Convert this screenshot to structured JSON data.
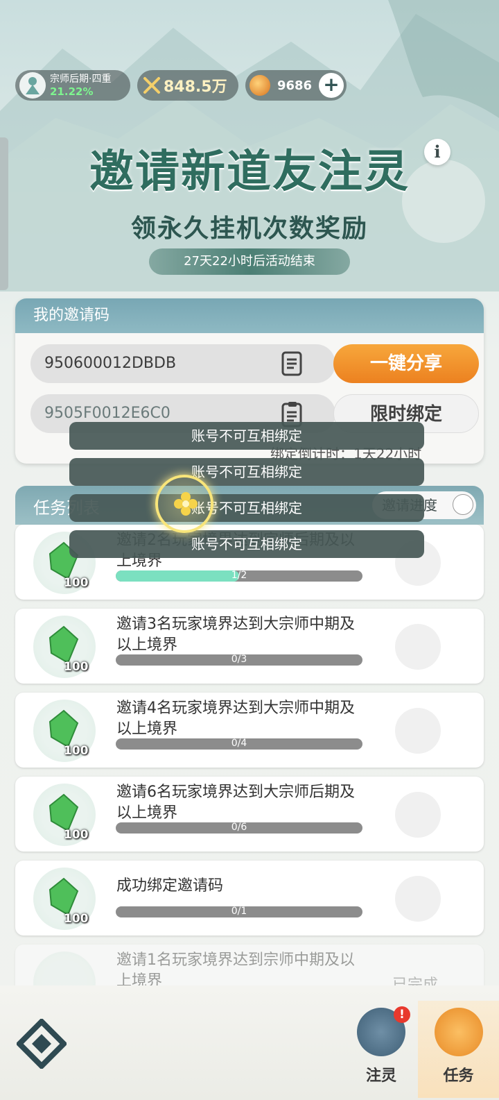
{
  "status": {
    "realm_name": "宗师后期·四重",
    "realm_progress": "21.22%",
    "power": "848.5万",
    "coins": "9686",
    "plus_label": "+"
  },
  "banner": {
    "title": "邀请新道友注灵",
    "subtitle": "领永久挂机次数奖励",
    "countdown": "27天22小时后活动结束",
    "info_label": "i"
  },
  "invite": {
    "header": "我的邀请码",
    "my_code": "950600012DBDB",
    "share_label": "一键分享",
    "bind_code_placeholder": "9505F0012E6C0",
    "bind_label": "限时绑定",
    "bind_countdown": "绑定倒计时：1天22小时"
  },
  "tasks": {
    "header": "任务列表",
    "progress_label": "邀请进度",
    "items": [
      {
        "text": "邀请2名玩家境界达到宗师后期及以上境界",
        "progress": "1/2",
        "fraction": 0.5,
        "reward": "100"
      },
      {
        "text": "邀请3名玩家境界达到大宗师中期及以上境界",
        "progress": "0/3",
        "fraction": 0,
        "reward": "100"
      },
      {
        "text": "邀请4名玩家境界达到大宗师中期及以上境界",
        "progress": "0/4",
        "fraction": 0,
        "reward": "100"
      },
      {
        "text": "邀请6名玩家境界达到大宗师后期及以上境界",
        "progress": "0/6",
        "fraction": 0,
        "reward": "100"
      },
      {
        "text": "成功绑定邀请码",
        "progress": "0/1",
        "fraction": 0,
        "reward": "100"
      },
      {
        "text": "邀请1名玩家境界达到宗师中期及以上境界",
        "status": "已完成"
      }
    ]
  },
  "toasts": [
    "账号不可互相绑定",
    "账号不可互相绑定",
    "账号不可互相绑定",
    "账号不可互相绑定"
  ],
  "nav": {
    "tab1_label": "注灵",
    "tab1_badge": "!",
    "tab2_label": "任务"
  },
  "colors": {
    "accent_orange": "#ec8120",
    "title_green": "#2f6d5f",
    "progress_fill": "#7be0c0"
  }
}
